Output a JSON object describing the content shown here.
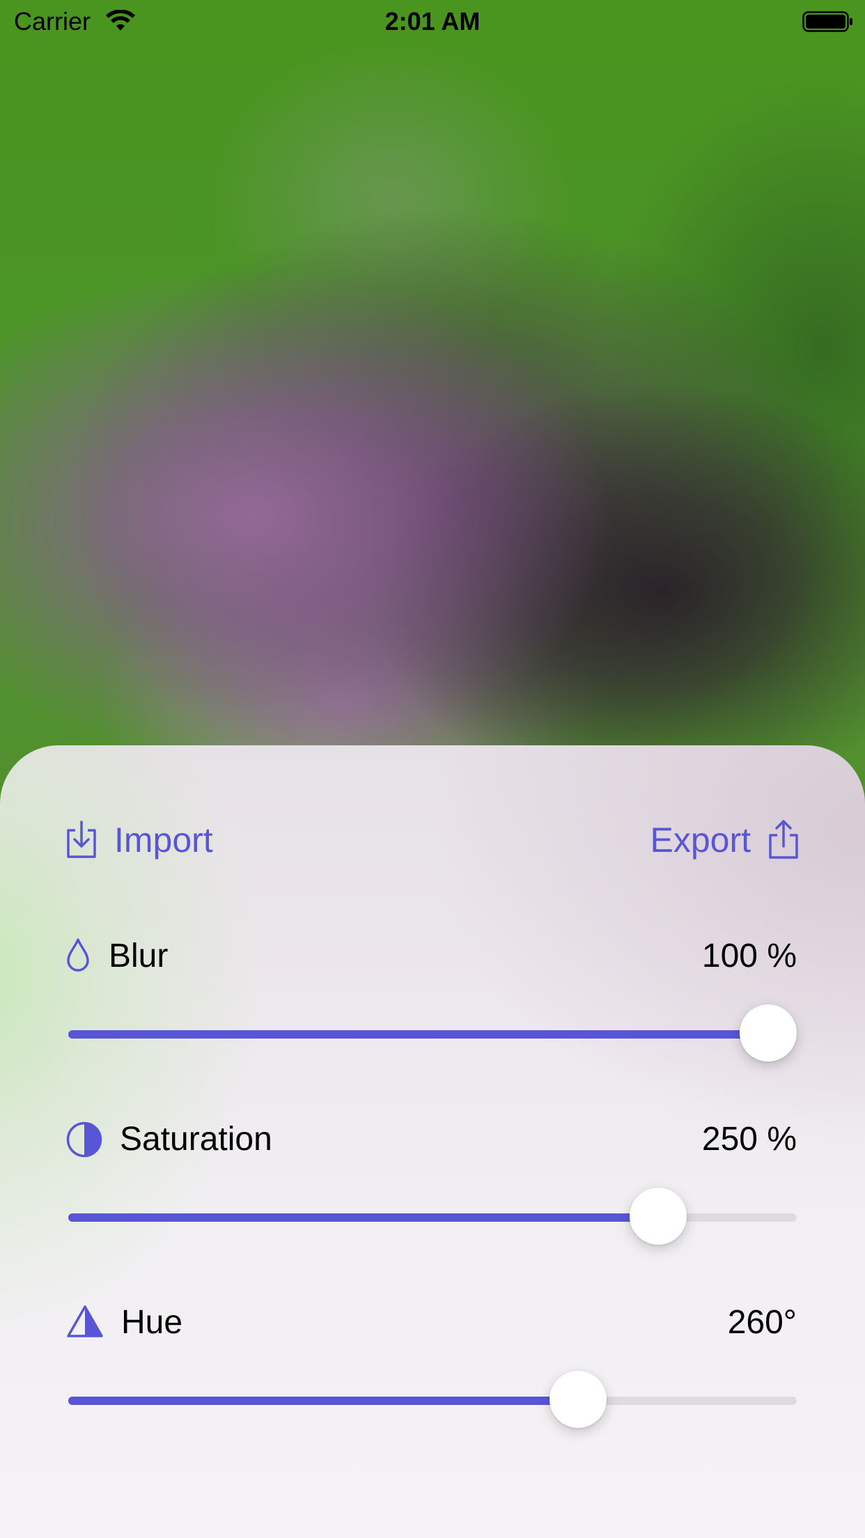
{
  "status_bar": {
    "carrier": "Carrier",
    "time": "2:01 AM",
    "wifi_icon": "wifi-icon",
    "battery_icon": "battery-full-icon"
  },
  "actions": {
    "import_label": "Import",
    "import_icon": "tray-arrow-down-icon",
    "export_label": "Export",
    "export_icon": "square-arrow-up-icon"
  },
  "controls": [
    {
      "id": "blur",
      "label": "Blur",
      "value": "100 %",
      "icon": "drop-icon",
      "level": 1.0
    },
    {
      "id": "saturation",
      "label": "Saturation",
      "value": "250 %",
      "icon": "half-circle-icon",
      "level": 0.81
    },
    {
      "id": "hue",
      "label": "Hue",
      "value": "260°",
      "icon": "triangle-half-icon",
      "level": 0.7
    }
  ],
  "colors": {
    "accent": "#5856d6",
    "track": "#dedadf",
    "thumb": "#ffffff"
  }
}
